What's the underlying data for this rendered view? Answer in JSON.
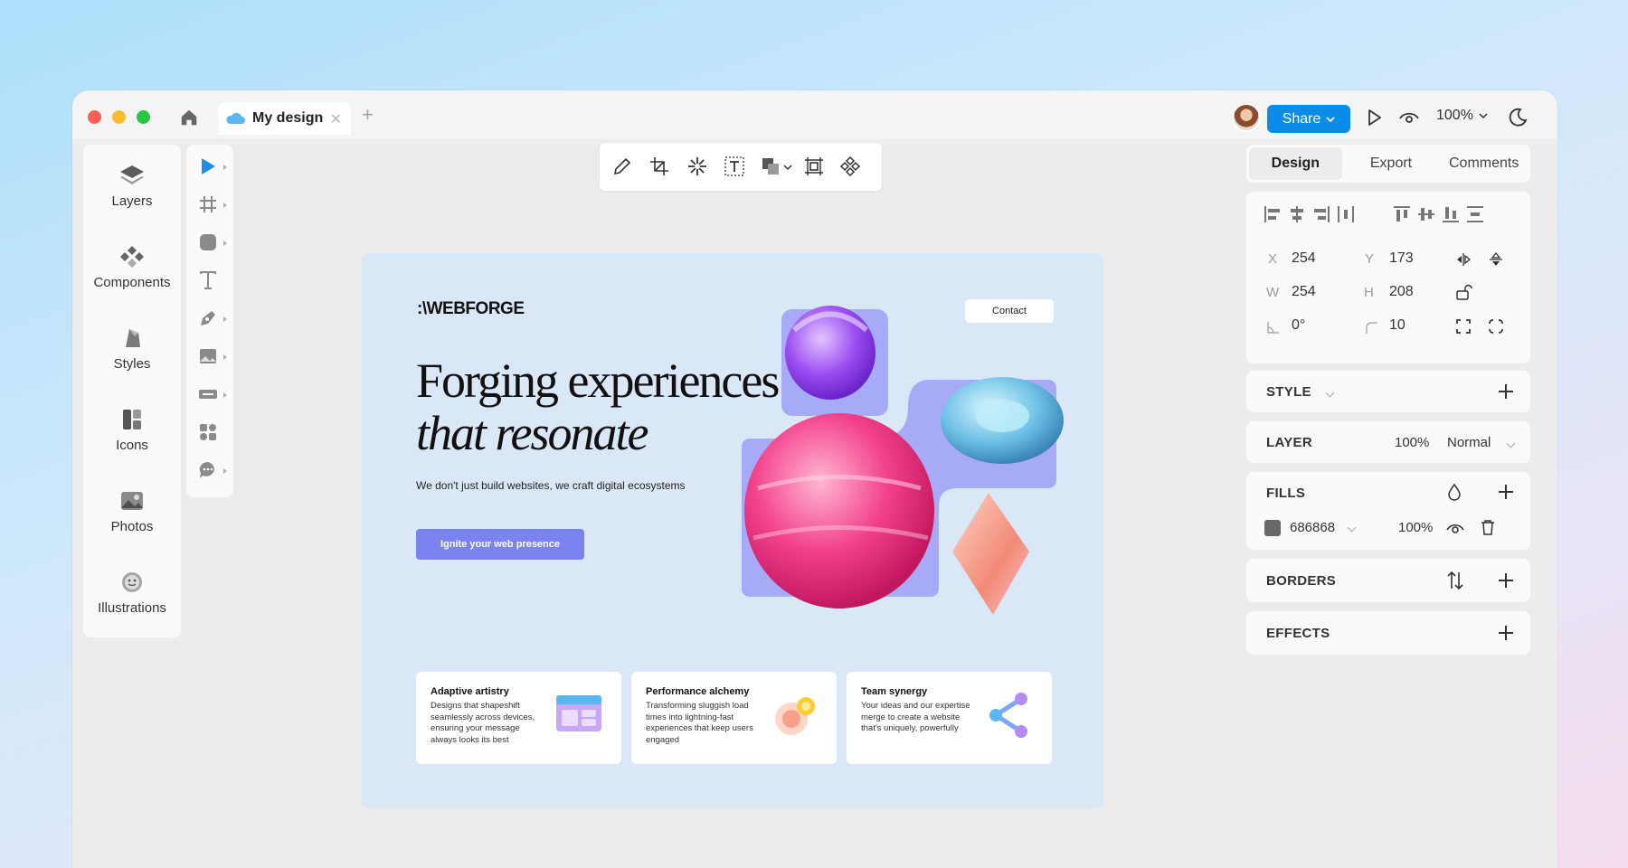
{
  "titlebar": {
    "tab_title": "My design",
    "share_label": "Share",
    "zoom": "100%"
  },
  "leftnav": {
    "items": [
      {
        "label": "Layers",
        "icon": "layers-icon"
      },
      {
        "label": "Components",
        "icon": "components-icon"
      },
      {
        "label": "Styles",
        "icon": "styles-icon"
      },
      {
        "label": "Icons",
        "icon": "icons-icon"
      },
      {
        "label": "Photos",
        "icon": "photos-icon"
      },
      {
        "label": "Illustrations",
        "icon": "illustrations-icon"
      }
    ]
  },
  "tools": [
    "select-tool",
    "frame-tool",
    "shape-tool",
    "text-tool",
    "pen-tool",
    "image-tool",
    "button-tool",
    "components-tool",
    "comment-tool"
  ],
  "floatbar_tools": [
    "pencil-icon",
    "crop-icon",
    "magic-icon",
    "text-box-icon",
    "boolean-icon",
    "frame-select-icon",
    "component-icon"
  ],
  "artboard": {
    "logo": ":\\WEBFORGE",
    "contact": "Contact",
    "headline_line1": "Forging experiences",
    "headline_line2": "that resonate",
    "subtitle": "We don't just build websites, we craft digital ecosystems",
    "cta": "Ignite your web presence",
    "cards": [
      {
        "title": "Adaptive artistry",
        "desc": "Designs that shapeshift seamlessly across devices, ensuring your message always looks its best"
      },
      {
        "title": "Performance alchemy",
        "desc": "Transforming sluggish load times into lightning-fast experiences that keep users engaged"
      },
      {
        "title": "Team synergy",
        "desc": "Your ideas and our expertise merge to create a website that's uniquely, powerfully"
      }
    ]
  },
  "panel": {
    "tabs": [
      "Design",
      "Export",
      "Comments"
    ],
    "active_tab": "Design",
    "x_label": "X",
    "x": "254",
    "y_label": "Y",
    "y": "173",
    "w_label": "W",
    "w": "254",
    "h_label": "H",
    "h": "208",
    "rotation": "0°",
    "radius": "10",
    "style_title": "STYLE",
    "layer_title": "LAYER",
    "layer_opacity": "100%",
    "layer_blend": "Normal",
    "fills_title": "FILLS",
    "fill_color": "686868",
    "fill_opacity": "100%",
    "borders_title": "BORDERS",
    "effects_title": "EFFECTS"
  },
  "colors": {
    "accent": "#0c8ce9",
    "cta": "#7b83f0",
    "fill_swatch": "#686868",
    "artboard": "#d9e7f6"
  }
}
